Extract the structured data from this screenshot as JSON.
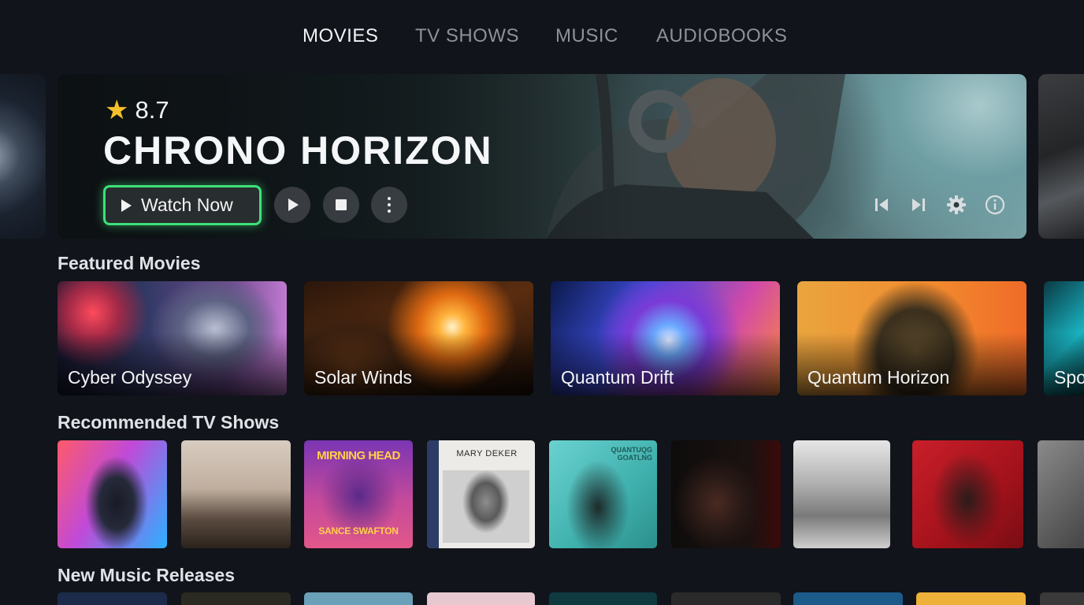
{
  "nav": {
    "tabs": [
      {
        "label": "MOVIES",
        "active": true
      },
      {
        "label": "TV SHOWS",
        "active": false
      },
      {
        "label": "MUSIC",
        "active": false
      },
      {
        "label": "AUDIOBOOKS",
        "active": false
      }
    ]
  },
  "hero": {
    "rating": "8.7",
    "rating_icon": "star-icon",
    "title": "CHRONO HORIZON",
    "watch_label": "Watch Now",
    "accent_color": "#3ee07a",
    "star_color": "#f6c02c",
    "buttons": [
      "play-icon",
      "stop-icon",
      "more-vertical-icon"
    ],
    "controls": [
      "skip-previous-icon",
      "skip-next-icon",
      "gear-icon",
      "info-icon"
    ]
  },
  "sections": {
    "featured": {
      "title": "Featured Movies",
      "items": [
        {
          "title": "Cyber Odyssey"
        },
        {
          "title": "Solar Winds"
        },
        {
          "title": "Quantum Drift"
        },
        {
          "title": "Quantum Horizon"
        },
        {
          "title": "Spo"
        }
      ]
    },
    "tv": {
      "title": "Recommended TV Shows",
      "art_text": {
        "card3_top": "MIRNING HEAD",
        "card3_bottom": "SANCE SWAFTON",
        "card4_top": "MARY DEKER",
        "card5_top": "QUANTUQG GOATLNG"
      }
    },
    "music": {
      "title": "New Music Releases"
    }
  }
}
